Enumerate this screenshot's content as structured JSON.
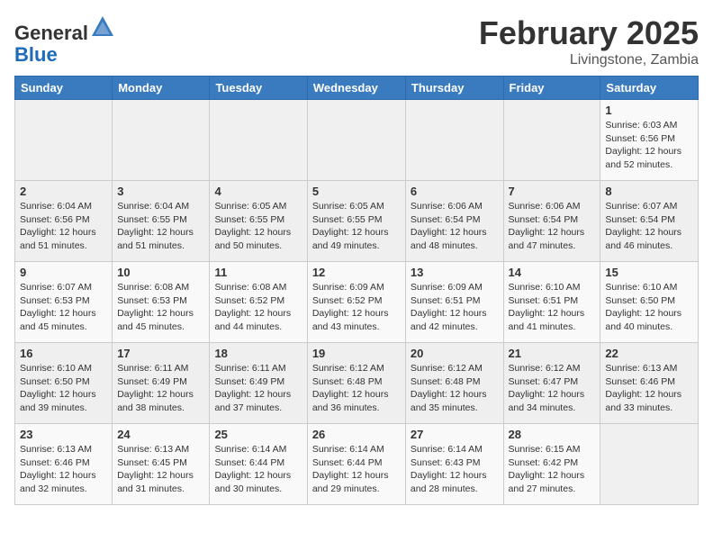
{
  "header": {
    "logo_line1": "General",
    "logo_line2": "Blue",
    "month_title": "February 2025",
    "location": "Livingstone, Zambia"
  },
  "days_of_week": [
    "Sunday",
    "Monday",
    "Tuesday",
    "Wednesday",
    "Thursday",
    "Friday",
    "Saturday"
  ],
  "weeks": [
    [
      {
        "day": "",
        "info": ""
      },
      {
        "day": "",
        "info": ""
      },
      {
        "day": "",
        "info": ""
      },
      {
        "day": "",
        "info": ""
      },
      {
        "day": "",
        "info": ""
      },
      {
        "day": "",
        "info": ""
      },
      {
        "day": "1",
        "info": "Sunrise: 6:03 AM\nSunset: 6:56 PM\nDaylight: 12 hours and 52 minutes."
      }
    ],
    [
      {
        "day": "2",
        "info": "Sunrise: 6:04 AM\nSunset: 6:56 PM\nDaylight: 12 hours and 51 minutes."
      },
      {
        "day": "3",
        "info": "Sunrise: 6:04 AM\nSunset: 6:55 PM\nDaylight: 12 hours and 51 minutes."
      },
      {
        "day": "4",
        "info": "Sunrise: 6:05 AM\nSunset: 6:55 PM\nDaylight: 12 hours and 50 minutes."
      },
      {
        "day": "5",
        "info": "Sunrise: 6:05 AM\nSunset: 6:55 PM\nDaylight: 12 hours and 49 minutes."
      },
      {
        "day": "6",
        "info": "Sunrise: 6:06 AM\nSunset: 6:54 PM\nDaylight: 12 hours and 48 minutes."
      },
      {
        "day": "7",
        "info": "Sunrise: 6:06 AM\nSunset: 6:54 PM\nDaylight: 12 hours and 47 minutes."
      },
      {
        "day": "8",
        "info": "Sunrise: 6:07 AM\nSunset: 6:54 PM\nDaylight: 12 hours and 46 minutes."
      }
    ],
    [
      {
        "day": "9",
        "info": "Sunrise: 6:07 AM\nSunset: 6:53 PM\nDaylight: 12 hours and 45 minutes."
      },
      {
        "day": "10",
        "info": "Sunrise: 6:08 AM\nSunset: 6:53 PM\nDaylight: 12 hours and 45 minutes."
      },
      {
        "day": "11",
        "info": "Sunrise: 6:08 AM\nSunset: 6:52 PM\nDaylight: 12 hours and 44 minutes."
      },
      {
        "day": "12",
        "info": "Sunrise: 6:09 AM\nSunset: 6:52 PM\nDaylight: 12 hours and 43 minutes."
      },
      {
        "day": "13",
        "info": "Sunrise: 6:09 AM\nSunset: 6:51 PM\nDaylight: 12 hours and 42 minutes."
      },
      {
        "day": "14",
        "info": "Sunrise: 6:10 AM\nSunset: 6:51 PM\nDaylight: 12 hours and 41 minutes."
      },
      {
        "day": "15",
        "info": "Sunrise: 6:10 AM\nSunset: 6:50 PM\nDaylight: 12 hours and 40 minutes."
      }
    ],
    [
      {
        "day": "16",
        "info": "Sunrise: 6:10 AM\nSunset: 6:50 PM\nDaylight: 12 hours and 39 minutes."
      },
      {
        "day": "17",
        "info": "Sunrise: 6:11 AM\nSunset: 6:49 PM\nDaylight: 12 hours and 38 minutes."
      },
      {
        "day": "18",
        "info": "Sunrise: 6:11 AM\nSunset: 6:49 PM\nDaylight: 12 hours and 37 minutes."
      },
      {
        "day": "19",
        "info": "Sunrise: 6:12 AM\nSunset: 6:48 PM\nDaylight: 12 hours and 36 minutes."
      },
      {
        "day": "20",
        "info": "Sunrise: 6:12 AM\nSunset: 6:48 PM\nDaylight: 12 hours and 35 minutes."
      },
      {
        "day": "21",
        "info": "Sunrise: 6:12 AM\nSunset: 6:47 PM\nDaylight: 12 hours and 34 minutes."
      },
      {
        "day": "22",
        "info": "Sunrise: 6:13 AM\nSunset: 6:46 PM\nDaylight: 12 hours and 33 minutes."
      }
    ],
    [
      {
        "day": "23",
        "info": "Sunrise: 6:13 AM\nSunset: 6:46 PM\nDaylight: 12 hours and 32 minutes."
      },
      {
        "day": "24",
        "info": "Sunrise: 6:13 AM\nSunset: 6:45 PM\nDaylight: 12 hours and 31 minutes."
      },
      {
        "day": "25",
        "info": "Sunrise: 6:14 AM\nSunset: 6:44 PM\nDaylight: 12 hours and 30 minutes."
      },
      {
        "day": "26",
        "info": "Sunrise: 6:14 AM\nSunset: 6:44 PM\nDaylight: 12 hours and 29 minutes."
      },
      {
        "day": "27",
        "info": "Sunrise: 6:14 AM\nSunset: 6:43 PM\nDaylight: 12 hours and 28 minutes."
      },
      {
        "day": "28",
        "info": "Sunrise: 6:15 AM\nSunset: 6:42 PM\nDaylight: 12 hours and 27 minutes."
      },
      {
        "day": "",
        "info": ""
      }
    ]
  ]
}
